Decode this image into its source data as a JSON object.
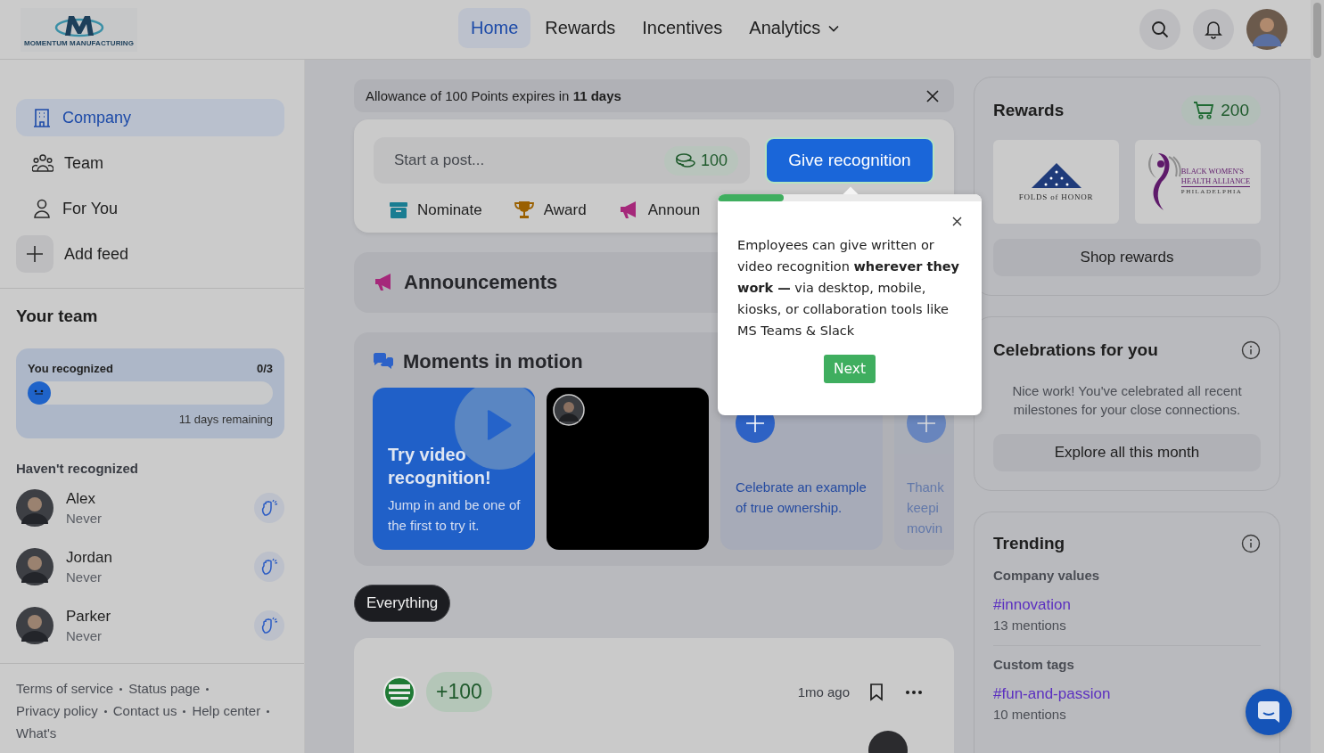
{
  "logo": {
    "text": "MOMENTUM MANUFACTURING"
  },
  "nav": [
    {
      "label": "Home",
      "selected": true,
      "kind": "link"
    },
    {
      "label": "Rewards",
      "selected": false,
      "kind": "link"
    },
    {
      "label": "Incentives",
      "selected": false,
      "kind": "link"
    },
    {
      "label": "Analytics",
      "selected": false,
      "kind": "dropdown"
    }
  ],
  "feeds": [
    {
      "label": "Company",
      "selected": true,
      "kind": "feed"
    },
    {
      "label": "Team",
      "selected": false,
      "kind": "feed"
    },
    {
      "label": "For You",
      "selected": false,
      "kind": "feed"
    },
    {
      "label": "Add feed",
      "selected": false,
      "kind": "add"
    }
  ],
  "your_team": {
    "title": "Your team",
    "progress": {
      "label": "You recognized",
      "count": "0/3",
      "level": 0,
      "remaining": "11 days remaining"
    },
    "subtitle": "Haven't recognized",
    "people": [
      {
        "name": "Alex",
        "last": "Never"
      },
      {
        "name": "Jordan",
        "last": "Never"
      },
      {
        "name": "Parker",
        "last": "Never"
      }
    ]
  },
  "footer_links": [
    "Terms of service",
    "Status page",
    "Privacy policy",
    "Contact us",
    "Help center",
    "What's"
  ],
  "allowance": {
    "text": "Allowance of 100 Points expires in **11 days**"
  },
  "composer": {
    "placeholder": "Start a post...",
    "points": "100",
    "button": "Give recognition",
    "actions": [
      {
        "label": "Nominate"
      },
      {
        "label": "Award"
      },
      {
        "label": "Announ"
      }
    ]
  },
  "tooltip": {
    "level": 0.25,
    "text": "Employees can give written or video recognition **wherever they work —** via desktop, mobile, kiosks, or collaboration tools like MS Teams & Slack",
    "button": "Next"
  },
  "announcements": {
    "title": "Announcements"
  },
  "moments": {
    "title": "Moments in motion",
    "cards": [
      {
        "kind": "promo",
        "title": "Try video recognition!",
        "lines": [
          "Jump in and be one of the first to try it."
        ]
      },
      {
        "kind": "video"
      },
      {
        "kind": "prompt",
        "faded": false,
        "lines": [
          "Celebrate an example of true ownership."
        ]
      },
      {
        "kind": "prompt",
        "faded": true,
        "lines": [
          "Thank",
          "keepi",
          "movin"
        ]
      }
    ]
  },
  "filter": {
    "label": "Everything",
    "selected": true
  },
  "post": {
    "points": "+100",
    "time": "1mo ago"
  },
  "rewards": {
    "title": "Rewards",
    "balance": "200",
    "partners": [
      {
        "kind": "flag",
        "lines": [
          "FOLDS of HONOR"
        ]
      },
      {
        "kind": "figure",
        "lines": [
          "BLACK WOMEN'S",
          "HEALTH ALLIANCE",
          "PHILADELPHIA"
        ]
      }
    ],
    "button": "Shop rewards"
  },
  "celebrations": {
    "title": "Celebrations for you",
    "text": "Nice work! You've celebrated all recent milestones for your close connections.",
    "button": "Explore all this month"
  },
  "trending": {
    "title": "Trending",
    "groups": [
      {
        "label": "Company values",
        "tags": [
          {
            "tag": "#innovation",
            "count": "13 mentions"
          }
        ]
      },
      {
        "label": "Custom tags",
        "tags": [
          {
            "tag": "#fun-and-passion",
            "count": "10 mentions"
          }
        ]
      }
    ]
  }
}
